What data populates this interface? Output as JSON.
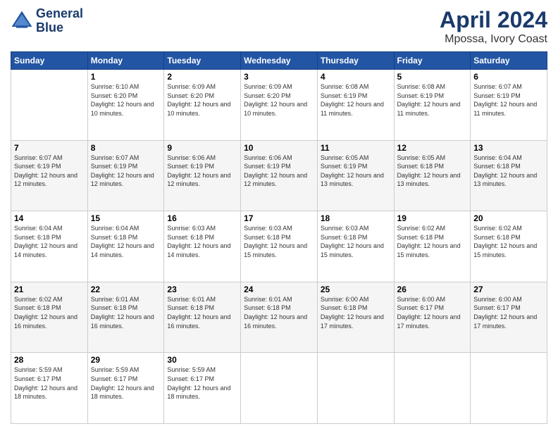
{
  "header": {
    "logo_line1": "General",
    "logo_line2": "Blue",
    "month": "April 2024",
    "location": "Mpossa, Ivory Coast"
  },
  "days_of_week": [
    "Sunday",
    "Monday",
    "Tuesday",
    "Wednesday",
    "Thursday",
    "Friday",
    "Saturday"
  ],
  "weeks": [
    [
      {
        "day": "",
        "sunrise": "",
        "sunset": "",
        "daylight": ""
      },
      {
        "day": "1",
        "sunrise": "6:10 AM",
        "sunset": "6:20 PM",
        "daylight": "12 hours and 10 minutes."
      },
      {
        "day": "2",
        "sunrise": "6:09 AM",
        "sunset": "6:20 PM",
        "daylight": "12 hours and 10 minutes."
      },
      {
        "day": "3",
        "sunrise": "6:09 AM",
        "sunset": "6:20 PM",
        "daylight": "12 hours and 10 minutes."
      },
      {
        "day": "4",
        "sunrise": "6:08 AM",
        "sunset": "6:19 PM",
        "daylight": "12 hours and 11 minutes."
      },
      {
        "day": "5",
        "sunrise": "6:08 AM",
        "sunset": "6:19 PM",
        "daylight": "12 hours and 11 minutes."
      },
      {
        "day": "6",
        "sunrise": "6:07 AM",
        "sunset": "6:19 PM",
        "daylight": "12 hours and 11 minutes."
      }
    ],
    [
      {
        "day": "7",
        "sunrise": "6:07 AM",
        "sunset": "6:19 PM",
        "daylight": "12 hours and 12 minutes."
      },
      {
        "day": "8",
        "sunrise": "6:07 AM",
        "sunset": "6:19 PM",
        "daylight": "12 hours and 12 minutes."
      },
      {
        "day": "9",
        "sunrise": "6:06 AM",
        "sunset": "6:19 PM",
        "daylight": "12 hours and 12 minutes."
      },
      {
        "day": "10",
        "sunrise": "6:06 AM",
        "sunset": "6:19 PM",
        "daylight": "12 hours and 12 minutes."
      },
      {
        "day": "11",
        "sunrise": "6:05 AM",
        "sunset": "6:19 PM",
        "daylight": "12 hours and 13 minutes."
      },
      {
        "day": "12",
        "sunrise": "6:05 AM",
        "sunset": "6:18 PM",
        "daylight": "12 hours and 13 minutes."
      },
      {
        "day": "13",
        "sunrise": "6:04 AM",
        "sunset": "6:18 PM",
        "daylight": "12 hours and 13 minutes."
      }
    ],
    [
      {
        "day": "14",
        "sunrise": "6:04 AM",
        "sunset": "6:18 PM",
        "daylight": "12 hours and 14 minutes."
      },
      {
        "day": "15",
        "sunrise": "6:04 AM",
        "sunset": "6:18 PM",
        "daylight": "12 hours and 14 minutes."
      },
      {
        "day": "16",
        "sunrise": "6:03 AM",
        "sunset": "6:18 PM",
        "daylight": "12 hours and 14 minutes."
      },
      {
        "day": "17",
        "sunrise": "6:03 AM",
        "sunset": "6:18 PM",
        "daylight": "12 hours and 15 minutes."
      },
      {
        "day": "18",
        "sunrise": "6:03 AM",
        "sunset": "6:18 PM",
        "daylight": "12 hours and 15 minutes."
      },
      {
        "day": "19",
        "sunrise": "6:02 AM",
        "sunset": "6:18 PM",
        "daylight": "12 hours and 15 minutes."
      },
      {
        "day": "20",
        "sunrise": "6:02 AM",
        "sunset": "6:18 PM",
        "daylight": "12 hours and 15 minutes."
      }
    ],
    [
      {
        "day": "21",
        "sunrise": "6:02 AM",
        "sunset": "6:18 PM",
        "daylight": "12 hours and 16 minutes."
      },
      {
        "day": "22",
        "sunrise": "6:01 AM",
        "sunset": "6:18 PM",
        "daylight": "12 hours and 16 minutes."
      },
      {
        "day": "23",
        "sunrise": "6:01 AM",
        "sunset": "6:18 PM",
        "daylight": "12 hours and 16 minutes."
      },
      {
        "day": "24",
        "sunrise": "6:01 AM",
        "sunset": "6:18 PM",
        "daylight": "12 hours and 16 minutes."
      },
      {
        "day": "25",
        "sunrise": "6:00 AM",
        "sunset": "6:18 PM",
        "daylight": "12 hours and 17 minutes."
      },
      {
        "day": "26",
        "sunrise": "6:00 AM",
        "sunset": "6:17 PM",
        "daylight": "12 hours and 17 minutes."
      },
      {
        "day": "27",
        "sunrise": "6:00 AM",
        "sunset": "6:17 PM",
        "daylight": "12 hours and 17 minutes."
      }
    ],
    [
      {
        "day": "28",
        "sunrise": "5:59 AM",
        "sunset": "6:17 PM",
        "daylight": "12 hours and 18 minutes."
      },
      {
        "day": "29",
        "sunrise": "5:59 AM",
        "sunset": "6:17 PM",
        "daylight": "12 hours and 18 minutes."
      },
      {
        "day": "30",
        "sunrise": "5:59 AM",
        "sunset": "6:17 PM",
        "daylight": "12 hours and 18 minutes."
      },
      {
        "day": "",
        "sunrise": "",
        "sunset": "",
        "daylight": ""
      },
      {
        "day": "",
        "sunrise": "",
        "sunset": "",
        "daylight": ""
      },
      {
        "day": "",
        "sunrise": "",
        "sunset": "",
        "daylight": ""
      },
      {
        "day": "",
        "sunrise": "",
        "sunset": "",
        "daylight": ""
      }
    ]
  ]
}
